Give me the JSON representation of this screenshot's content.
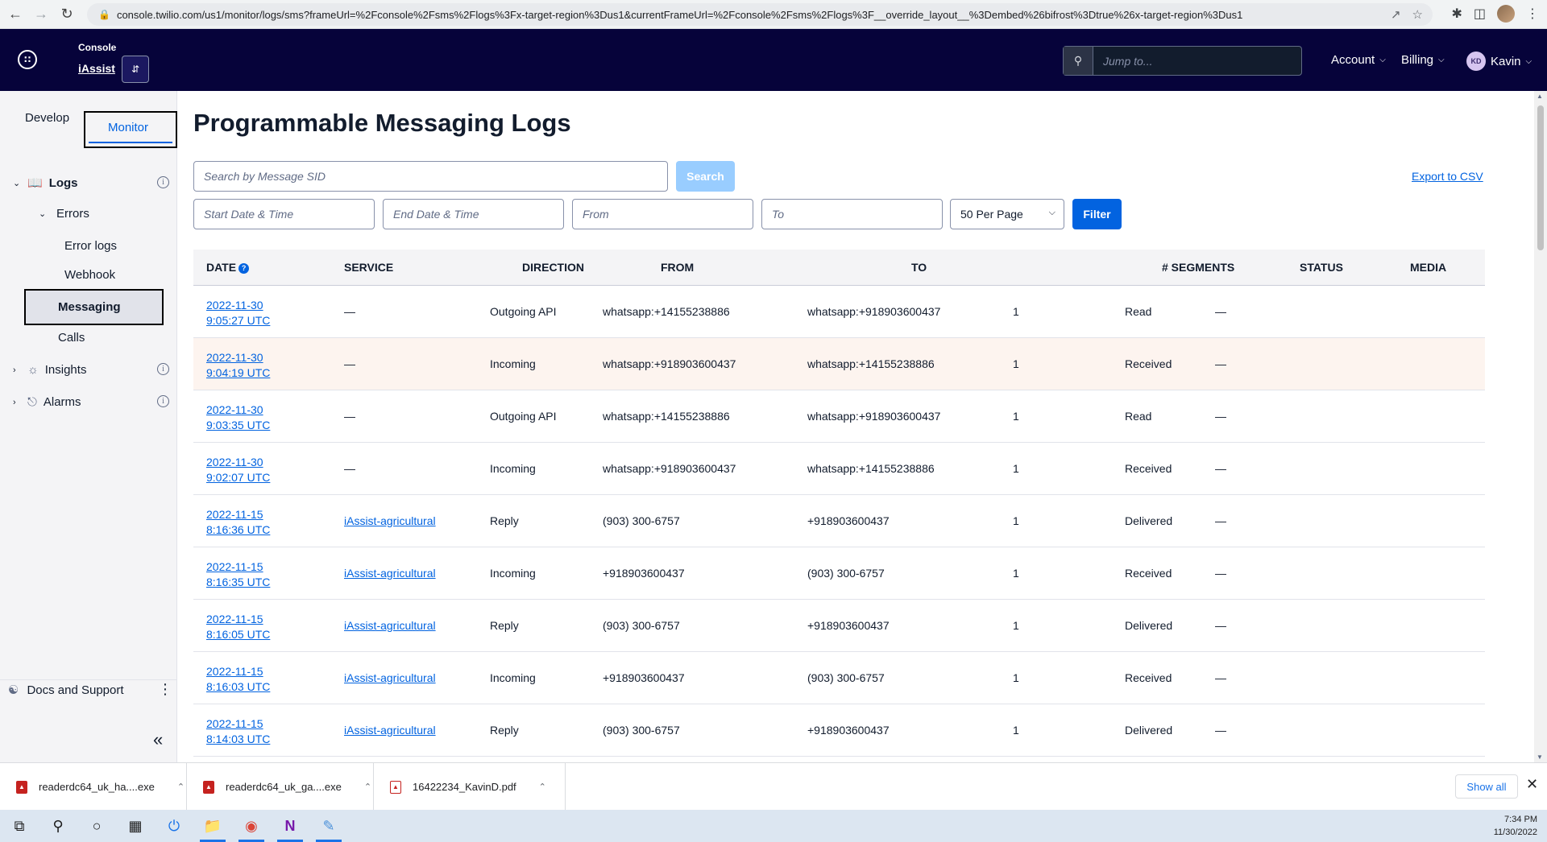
{
  "browser": {
    "url": "console.twilio.com/us1/monitor/logs/sms?frameUrl=%2Fconsole%2Fsms%2Flogs%3Fx-target-region%3Dus1&currentFrameUrl=%2Fconsole%2Fsms%2Flogs%3F__override_layout__%3Dembed%26bifrost%3Dtrue%26x-target-region%3Dus1"
  },
  "topnav": {
    "console_label": "Console",
    "account_name": "iAssist",
    "jump_placeholder": "Jump to...",
    "account_menu": "Account",
    "billing_menu": "Billing",
    "user_initials": "KD",
    "user_name": "Kavin"
  },
  "sidebar": {
    "tab_develop": "Develop",
    "tab_monitor": "Monitor",
    "logs": "Logs",
    "errors": "Errors",
    "error_logs": "Error logs",
    "webhook": "Webhook",
    "messaging": "Messaging",
    "calls": "Calls",
    "insights": "Insights",
    "alarms": "Alarms",
    "docs_support": "Docs and Support"
  },
  "main": {
    "title": "Programmable Messaging Logs",
    "search_placeholder": "Search by Message SID",
    "search_button": "Search",
    "export_link": "Export to CSV",
    "start_placeholder": "Start Date & Time",
    "end_placeholder": "End Date & Time",
    "from_placeholder": "From",
    "to_placeholder": "To",
    "per_page": "50 Per Page",
    "filter_button": "Filter"
  },
  "table": {
    "headers": {
      "date": "Date",
      "service": "Service",
      "direction": "Direction",
      "from": "From",
      "to": "To",
      "segments": "# Segments",
      "status": "Status",
      "media": "Media"
    },
    "rows": [
      {
        "date": "2022-11-30",
        "time": "9:05:27 UTC",
        "service": "—",
        "direction": "Outgoing API",
        "from": "whatsapp:+14155238886",
        "to": "whatsapp:+918903600437",
        "segments": "1",
        "status": "Read",
        "media": "—"
      },
      {
        "date": "2022-11-30",
        "time": "9:04:19 UTC",
        "service": "—",
        "direction": "Incoming",
        "from": "whatsapp:+918903600437",
        "to": "whatsapp:+14155238886",
        "segments": "1",
        "status": "Received",
        "media": "—"
      },
      {
        "date": "2022-11-30",
        "time": "9:03:35 UTC",
        "service": "—",
        "direction": "Outgoing API",
        "from": "whatsapp:+14155238886",
        "to": "whatsapp:+918903600437",
        "segments": "1",
        "status": "Read",
        "media": "—"
      },
      {
        "date": "2022-11-30",
        "time": "9:02:07 UTC",
        "service": "—",
        "direction": "Incoming",
        "from": "whatsapp:+918903600437",
        "to": "whatsapp:+14155238886",
        "segments": "1",
        "status": "Received",
        "media": "—"
      },
      {
        "date": "2022-11-15",
        "time": "8:16:36 UTC",
        "service": "iAssist-agricultural",
        "direction": "Reply",
        "from": "(903) 300-6757",
        "to": "+918903600437",
        "segments": "1",
        "status": "Delivered",
        "media": "—"
      },
      {
        "date": "2022-11-15",
        "time": "8:16:35 UTC",
        "service": "iAssist-agricultural",
        "direction": "Incoming",
        "from": "+918903600437",
        "to": "(903) 300-6757",
        "segments": "1",
        "status": "Received",
        "media": "—"
      },
      {
        "date": "2022-11-15",
        "time": "8:16:05 UTC",
        "service": "iAssist-agricultural",
        "direction": "Reply",
        "from": "(903) 300-6757",
        "to": "+918903600437",
        "segments": "1",
        "status": "Delivered",
        "media": "—"
      },
      {
        "date": "2022-11-15",
        "time": "8:16:03 UTC",
        "service": "iAssist-agricultural",
        "direction": "Incoming",
        "from": "+918903600437",
        "to": "(903) 300-6757",
        "segments": "1",
        "status": "Received",
        "media": "—"
      },
      {
        "date": "2022-11-15",
        "time": "8:14:03 UTC",
        "service": "iAssist-agricultural",
        "direction": "Reply",
        "from": "(903) 300-6757",
        "to": "+918903600437",
        "segments": "1",
        "status": "Delivered",
        "media": "—"
      }
    ]
  },
  "downloads": {
    "items": [
      "readerdc64_uk_ha....exe",
      "readerdc64_uk_ga....exe",
      "16422234_KavinD.pdf"
    ],
    "show_all": "Show all"
  },
  "taskbar": {
    "time": "7:34 PM",
    "date": "11/30/2022"
  }
}
